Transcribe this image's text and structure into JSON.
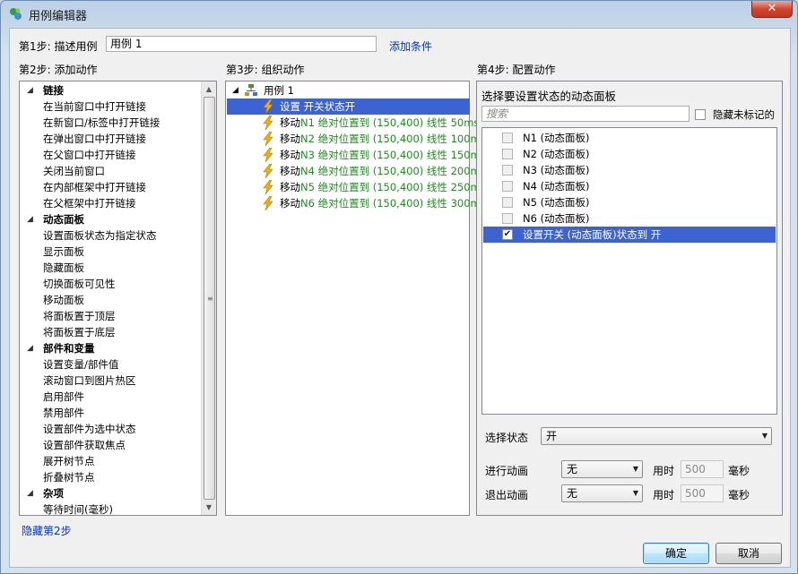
{
  "window": {
    "title": "用例编辑器",
    "close_glyph": "✕"
  },
  "step1": {
    "label": "第1步: 描述用例",
    "case_name": "用例 1",
    "add_condition": "添加条件"
  },
  "step2": {
    "label": "第2步: 添加动作",
    "categories": [
      {
        "name": "链接",
        "items": [
          "在当前窗口中打开链接",
          "在新窗口/标签中打开链接",
          "在弹出窗口中打开链接",
          "在父窗口中打开链接",
          "关闭当前窗口",
          "在内部框架中打开链接",
          "在父框架中打开链接"
        ]
      },
      {
        "name": "动态面板",
        "items": [
          "设置面板状态为指定状态",
          "显示面板",
          "隐藏面板",
          "切换面板可见性",
          "移动面板",
          "将面板置于顶层",
          "将面板置于底层"
        ]
      },
      {
        "name": "部件和变量",
        "items": [
          "设置变量/部件值",
          "滚动窗口到图片热区",
          "启用部件",
          "禁用部件",
          "设置部件为选中状态",
          "设置部件获取焦点",
          "展开树节点",
          "折叠树节点"
        ]
      },
      {
        "name": "杂项",
        "items": [
          "等待时间(毫秒)"
        ]
      }
    ],
    "hide_link": "隐藏第2步"
  },
  "step3": {
    "label": "第3步: 组织动作",
    "root": "用例 1",
    "actions": [
      {
        "prefix": "设置 开关状态开",
        "detail": ""
      },
      {
        "prefix": "移动",
        "detail": "N1 绝对位置到 (150,400) 线性 50ms"
      },
      {
        "prefix": "移动",
        "detail": "N2 绝对位置到 (150,400) 线性 100ms"
      },
      {
        "prefix": "移动",
        "detail": "N3 绝对位置到 (150,400) 线性 150ms"
      },
      {
        "prefix": "移动",
        "detail": "N4 绝对位置到 (150,400) 线性 200ms"
      },
      {
        "prefix": "移动",
        "detail": "N5 绝对位置到 (150,400) 线性 250ms"
      },
      {
        "prefix": "移动",
        "detail": "N6 绝对位置到 (150,400) 线性 300ms"
      }
    ],
    "selected_index": 0
  },
  "step4": {
    "label": "第4步: 配置动作",
    "panel_title": "选择要设置状态的动态面板",
    "search_placeholder": "搜索",
    "hide_unmarked": "隐藏未标记的",
    "panels": [
      {
        "label": "N1 (动态面板)",
        "checked": false
      },
      {
        "label": "N2 (动态面板)",
        "checked": false
      },
      {
        "label": "N3 (动态面板)",
        "checked": false
      },
      {
        "label": "N4 (动态面板)",
        "checked": false
      },
      {
        "label": "N5 (动态面板)",
        "checked": false
      },
      {
        "label": "N6 (动态面板)",
        "checked": false
      },
      {
        "label": "设置开关 (动态面板)状态到 开",
        "checked": true
      }
    ],
    "state_label": "选择状态",
    "state_value": "开",
    "enter_anim_label": "进行动画",
    "enter_anim_value": "无",
    "exit_anim_label": "退出动画",
    "exit_anim_value": "无",
    "duration_label": "用时",
    "duration_value": "500",
    "ms_label": "毫秒"
  },
  "buttons": {
    "ok": "确定",
    "cancel": "取消"
  },
  "colors": {
    "selection": "#3d63d2",
    "link": "#0033cc",
    "green_text": "#1c8f1c",
    "bolt": "#f2b200"
  }
}
